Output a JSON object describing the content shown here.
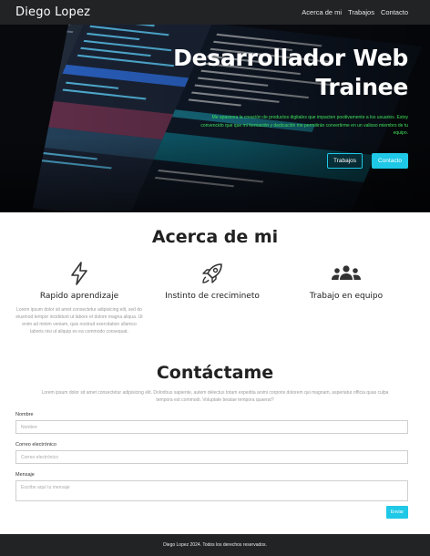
{
  "navbar": {
    "brand": "Diego Lopez",
    "links": [
      "Acerca de mi",
      "Trabajos",
      "Contacto"
    ]
  },
  "hero": {
    "title": "Desarrollador Web Trainee",
    "text": "Me apasiona la creación de productos digitales que impacten positivamente a los usuarios. Estoy convencido que que mi formación y dedicación me permitirán convertirme en un valioso miembro de tu equipo.",
    "buttons": {
      "works": "Trabajos",
      "contact": "Contacto"
    }
  },
  "about": {
    "title": "Acerca de mi",
    "features": [
      {
        "icon": "lightning-icon",
        "title": "Rapido aprendizaje",
        "text": "Lorem ipsum dolor sit amet consectetur adipisicing elit, sed do eiusmod tempor incididunt ut labore et dolore magna aliqua. Ut enim ad minim veniam, quis nostrud exercitation ullamco laboris nisi ut aliquip ex ea commodo consequat."
      },
      {
        "icon": "rocket-icon",
        "title": "Instinto de crecimineto",
        "text": ""
      },
      {
        "icon": "people-group-icon",
        "title": "Trabajo en equipo",
        "text": ""
      }
    ]
  },
  "contact": {
    "title": "Contáctame",
    "intro": "Lorem ipsum dolor sit amet consectetur adipisicing elit. Doloribus sapiente, autem delectus totam expedita animi corporis dolorem qui magnam, asperiatur officia quas culpa tempora est commodi. Voluptate beatae tempora quaerat?",
    "fields": {
      "name_label": "Nombre",
      "name_placeholder": "Nombre",
      "email_label": "Correo electrónico",
      "email_placeholder": "Correo electrónico",
      "message_label": "Mensaje",
      "message_placeholder": "Escribe aquí tu mensaje"
    },
    "send_label": "Enviar"
  },
  "footer": {
    "text": "Diego Lopez 2024. Todos los derechos reservados."
  },
  "colors": {
    "accent": "#1ec8e6",
    "dark": "#222325",
    "hero_text": "#3ee05a"
  }
}
